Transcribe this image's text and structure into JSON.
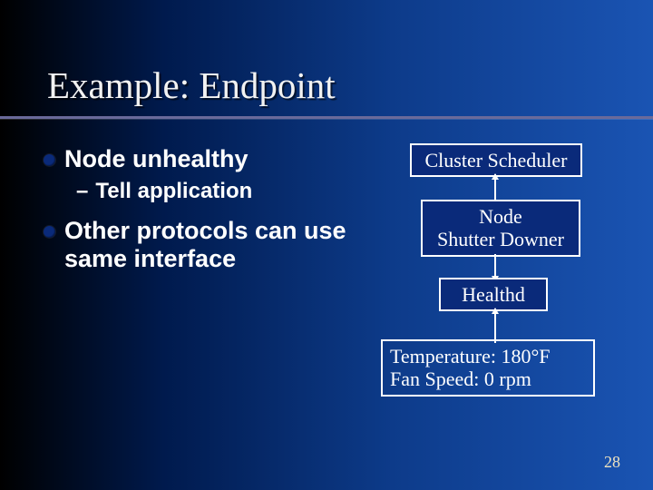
{
  "title": "Example: Endpoint",
  "bullets": {
    "b1": "Node unhealthy",
    "b1_sub": "Tell application",
    "b2": "Other protocols can use same interface"
  },
  "diagram": {
    "box1": "Cluster Scheduler",
    "box2_line1": "Node",
    "box2_line2": "Shutter Downer",
    "box3": "Healthd",
    "box4_line1": "Temperature: 180°F",
    "box4_line2": "Fan Speed: 0 rpm"
  },
  "page_number": "28"
}
